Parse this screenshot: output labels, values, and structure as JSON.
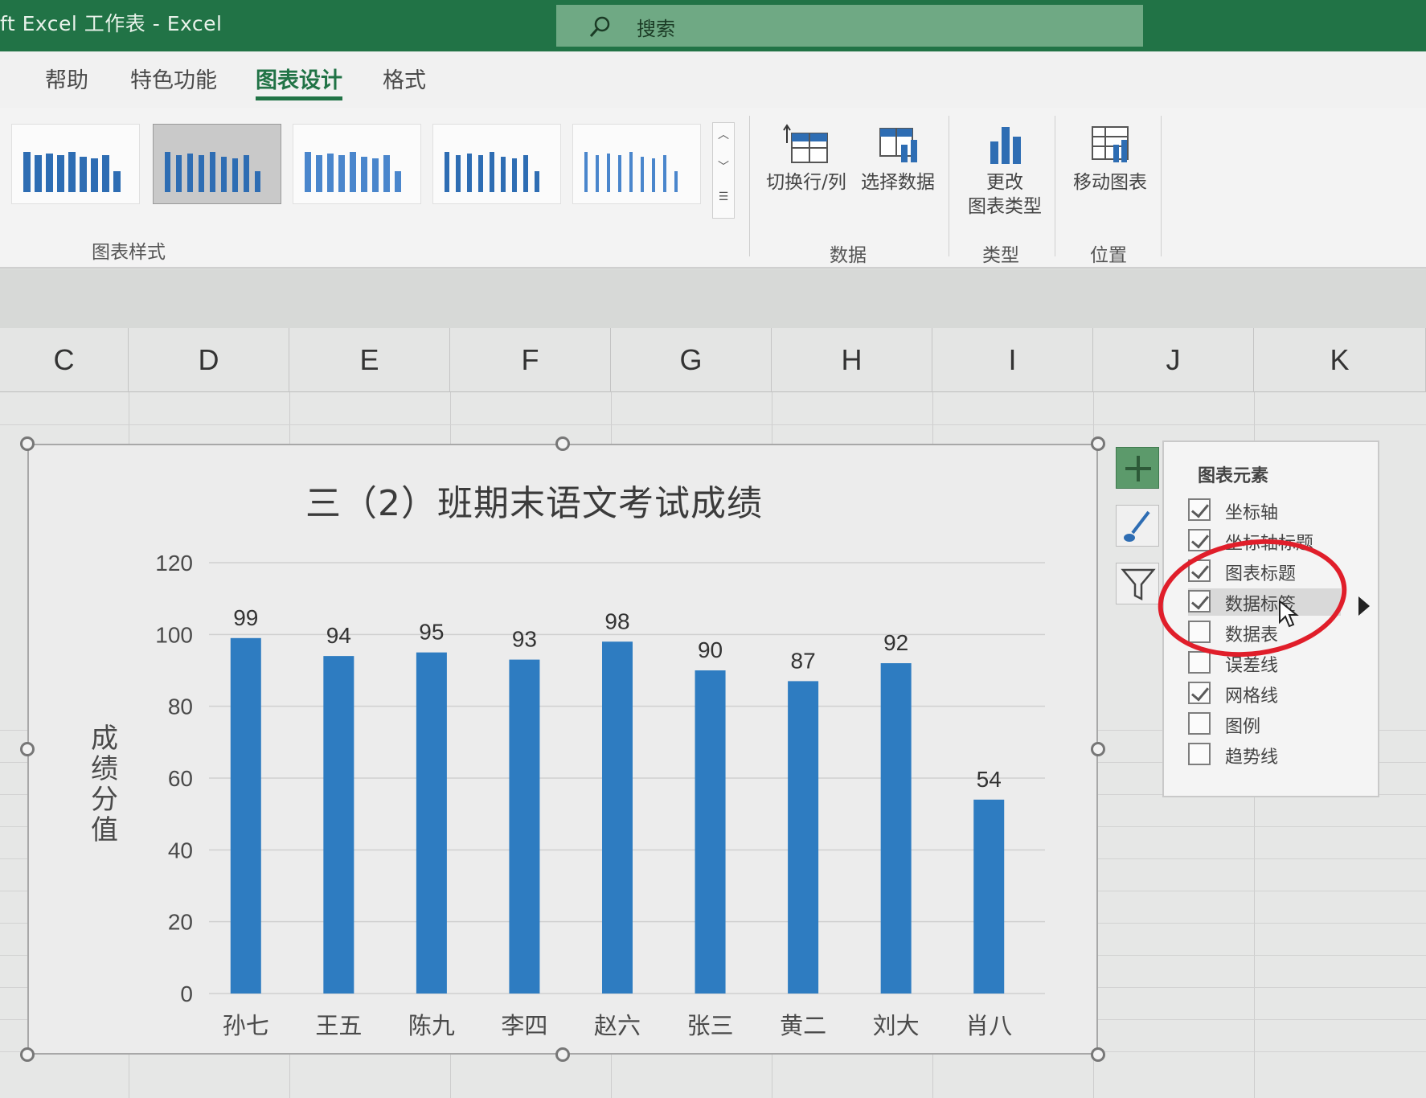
{
  "window": {
    "title": "ft Excel 工作表  -  Excel"
  },
  "search": {
    "label": "搜索"
  },
  "tabs": [
    {
      "label": "帮助"
    },
    {
      "label": "特色功能"
    },
    {
      "label": "图表设计"
    },
    {
      "label": "格式"
    }
  ],
  "ribbon": {
    "chart_styles_label": "图表样式",
    "switch_row_col_label": "切换行/列",
    "select_data_label": "选择数据",
    "data_group_label": "数据",
    "change_type_label_1": "更改",
    "change_type_label_2": "图表类型",
    "type_group_label": "类型",
    "move_chart_label": "移动图表",
    "location_group_label": "位置"
  },
  "columns": [
    "C",
    "D",
    "E",
    "F",
    "G",
    "H",
    "I",
    "J",
    "K"
  ],
  "chart_data": {
    "type": "bar",
    "title": "三（2）班期末语文考试成绩",
    "ylabel": "成绩分值",
    "xlabel": "",
    "categories": [
      "孙七",
      "王五",
      "陈九",
      "李四",
      "赵六",
      "张三",
      "黄二",
      "刘大",
      "肖八"
    ],
    "values": [
      99,
      94,
      95,
      93,
      98,
      90,
      87,
      92,
      54
    ],
    "ylim": [
      0,
      120
    ],
    "yticks": [
      0,
      20,
      40,
      60,
      80,
      100,
      120
    ],
    "grid": true,
    "legend": "none",
    "bar_color": "#2e7cc1"
  },
  "panel": {
    "title": "图表元素",
    "items": [
      {
        "label": "坐标轴",
        "checked": true
      },
      {
        "label": "坐标轴标题",
        "checked": true
      },
      {
        "label": "图表标题",
        "checked": true
      },
      {
        "label": "数据标签",
        "checked": true
      },
      {
        "label": "数据表",
        "checked": false
      },
      {
        "label": "误差线",
        "checked": false
      },
      {
        "label": "网格线",
        "checked": true
      },
      {
        "label": "图例",
        "checked": false
      },
      {
        "label": "趋势线",
        "checked": false
      }
    ]
  },
  "colors": {
    "excel_green": "#217346",
    "bar_blue": "#2e7cc1",
    "annotation_red": "#e01e2a"
  }
}
